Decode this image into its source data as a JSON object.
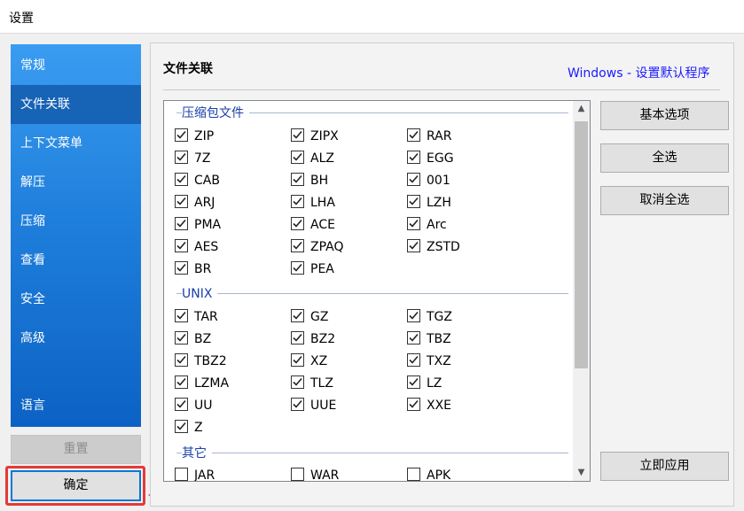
{
  "window": {
    "title": "设置"
  },
  "sidebar": {
    "items": [
      {
        "label": "常规"
      },
      {
        "label": "文件关联",
        "active": true
      },
      {
        "label": "上下文菜单"
      },
      {
        "label": "解压"
      },
      {
        "label": "压缩"
      },
      {
        "label": "查看"
      },
      {
        "label": "安全"
      },
      {
        "label": "高级"
      },
      {
        "label": "语言"
      }
    ]
  },
  "buttons": {
    "reset": "重置",
    "ok": "确定"
  },
  "main": {
    "title": "文件关联",
    "windows_link": "Windows - 设置默认程序",
    "groups": [
      {
        "name": "压缩包文件",
        "items": [
          {
            "label": "ZIP",
            "checked": true
          },
          {
            "label": "ZIPX",
            "checked": true
          },
          {
            "label": "RAR",
            "checked": true
          },
          {
            "label": "7Z",
            "checked": true
          },
          {
            "label": "ALZ",
            "checked": true
          },
          {
            "label": "EGG",
            "checked": true
          },
          {
            "label": "CAB",
            "checked": true
          },
          {
            "label": "BH",
            "checked": true
          },
          {
            "label": "001",
            "checked": true
          },
          {
            "label": "ARJ",
            "checked": true
          },
          {
            "label": "LHA",
            "checked": true
          },
          {
            "label": "LZH",
            "checked": true
          },
          {
            "label": "PMA",
            "checked": true
          },
          {
            "label": "ACE",
            "checked": true
          },
          {
            "label": "Arc",
            "checked": true
          },
          {
            "label": "AES",
            "checked": true
          },
          {
            "label": "ZPAQ",
            "checked": true
          },
          {
            "label": "ZSTD",
            "checked": true
          },
          {
            "label": "BR",
            "checked": true
          },
          {
            "label": "PEA",
            "checked": true
          }
        ]
      },
      {
        "name": "UNIX",
        "items": [
          {
            "label": "TAR",
            "checked": true
          },
          {
            "label": "GZ",
            "checked": true
          },
          {
            "label": "TGZ",
            "checked": true
          },
          {
            "label": "BZ",
            "checked": true
          },
          {
            "label": "BZ2",
            "checked": true
          },
          {
            "label": "TBZ",
            "checked": true
          },
          {
            "label": "TBZ2",
            "checked": true
          },
          {
            "label": "XZ",
            "checked": true
          },
          {
            "label": "TXZ",
            "checked": true
          },
          {
            "label": "LZMA",
            "checked": true
          },
          {
            "label": "TLZ",
            "checked": true
          },
          {
            "label": "LZ",
            "checked": true
          },
          {
            "label": "UU",
            "checked": true
          },
          {
            "label": "UUE",
            "checked": true
          },
          {
            "label": "XXE",
            "checked": true
          },
          {
            "label": "Z",
            "checked": true
          }
        ]
      },
      {
        "name": "其它",
        "items": [
          {
            "label": "JAR",
            "checked": false
          },
          {
            "label": "WAR",
            "checked": false
          },
          {
            "label": "APK",
            "checked": false
          }
        ]
      }
    ]
  },
  "right_buttons": {
    "basic": "基本选项",
    "select_all": "全选",
    "deselect_all": "取消全选",
    "apply": "立即应用"
  },
  "colors": {
    "sidebar_top": "#3a9cf0",
    "sidebar_bottom": "#0c62c4",
    "accent": "#0078d7",
    "highlight": "#e53935",
    "link": "#1a1aff"
  },
  "icons": {
    "checkbox_checked": "check-icon",
    "scroll_up": "chevron-up-icon",
    "scroll_down": "chevron-down-icon",
    "arrow": "red-arrow-icon"
  }
}
